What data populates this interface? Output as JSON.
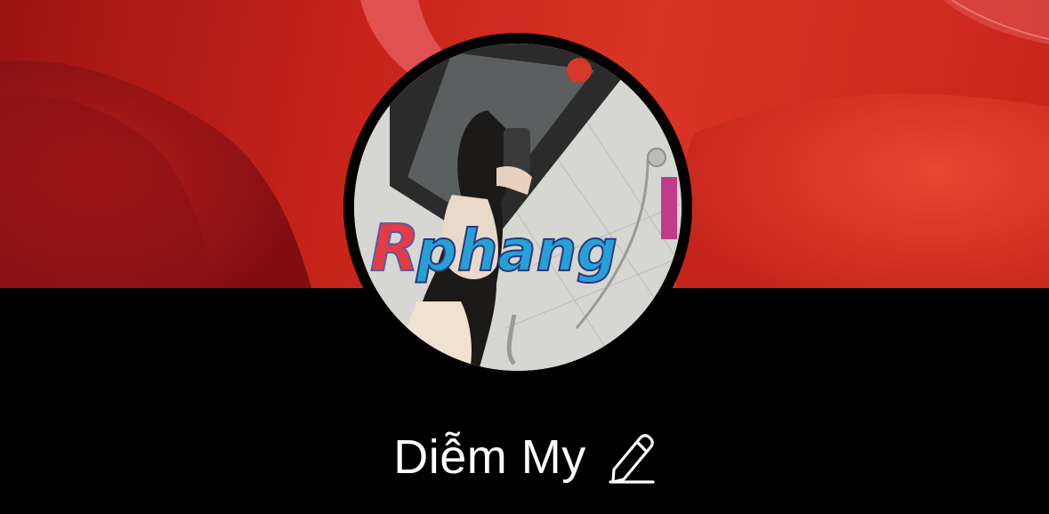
{
  "profile": {
    "name": "Diễm My",
    "avatar_watermark": "Rphang"
  },
  "icons": {
    "edit": "pencil-icon"
  },
  "colors": {
    "cover_red": "#c8241a",
    "background": "#000000",
    "text": "#ffffff"
  }
}
